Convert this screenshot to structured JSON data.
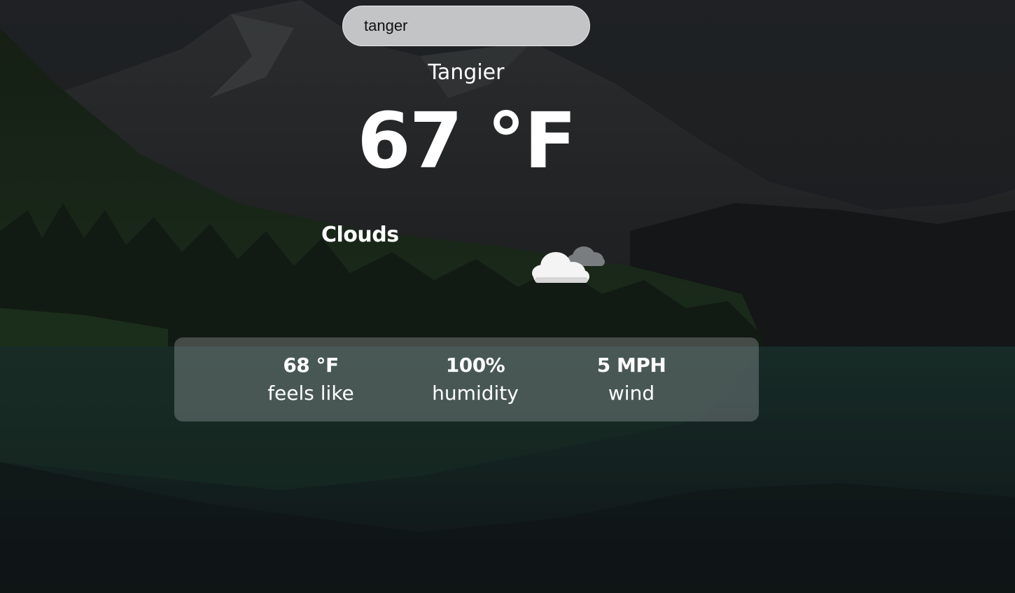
{
  "search": {
    "value": "tanger"
  },
  "weather": {
    "city": "Tangier",
    "temperature": "67 °F",
    "description": "Clouds",
    "icon": "clouds-icon"
  },
  "stats": [
    {
      "value": "68 °F",
      "label": "feels like"
    },
    {
      "value": "100%",
      "label": "humidity"
    },
    {
      "value": "5 MPH",
      "label": "wind"
    }
  ]
}
